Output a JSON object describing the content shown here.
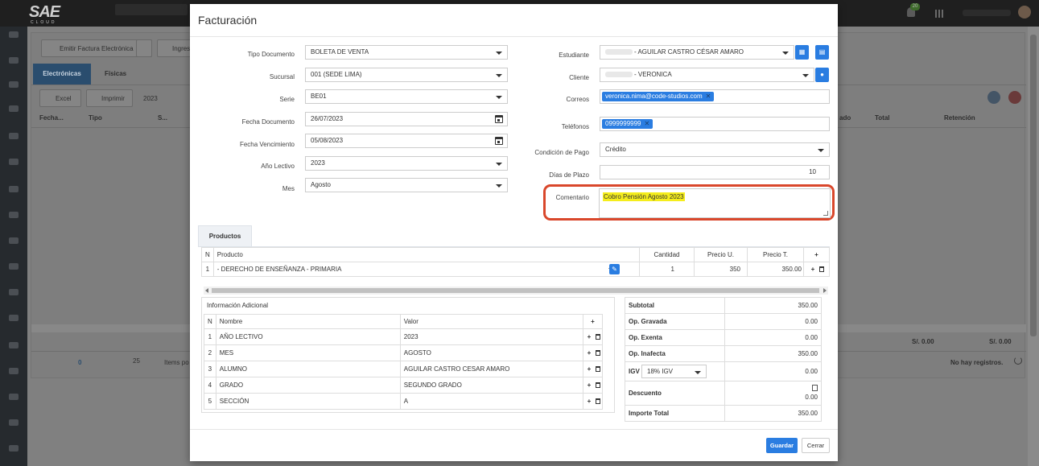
{
  "app": {
    "logo": "SAE",
    "logo_sub": "CLOUD",
    "notif_count": "20"
  },
  "bg": {
    "toolbar": {
      "emitir": "Emitir Factura Electrónica",
      "ingresar": "Ingres"
    },
    "tabs": [
      "Electrónicas",
      "Físicas"
    ],
    "excel": "Excel",
    "imprimir": "Imprimir",
    "year": "2023",
    "columns": {
      "fecha": "Fecha...",
      "tipo": "Tipo",
      "s": "S...",
      "estado": "ado",
      "total": "Total",
      "retencion": "Retención"
    },
    "footer": {
      "page": "0",
      "pagesize": "25",
      "items_por": "Items po",
      "sum1": "S/. 0.00",
      "sum2": "S/. 0.00",
      "no_records": "No hay registros."
    }
  },
  "modal": {
    "title": "Facturación",
    "left_fields": [
      {
        "label": "Tipo Documento",
        "value": "BOLETA DE VENTA",
        "kind": "select"
      },
      {
        "label": "Sucursal",
        "value": "001 (SEDE LIMA)",
        "kind": "select"
      },
      {
        "label": "Serie",
        "value": "BE01",
        "kind": "select"
      },
      {
        "label": "Fecha Documento",
        "value": "26/07/2023",
        "kind": "date"
      },
      {
        "label": "Fecha Vencimiento",
        "value": "05/08/2023",
        "kind": "date"
      },
      {
        "label": "Año Lectivo",
        "value": "2023",
        "kind": "select"
      },
      {
        "label": "Mes",
        "value": "Agosto",
        "kind": "select"
      }
    ],
    "estudiante": {
      "label": "Estudiante",
      "value": "- AGUILAR CASTRO CÉSAR AMARO"
    },
    "cliente": {
      "label": "Cliente",
      "value": "- VERONICA"
    },
    "correos": {
      "label": "Correos",
      "chip": "veronica.nima@code-studios.com"
    },
    "telefonos": {
      "label": "Teléfonos",
      "chip": "0999999999"
    },
    "condicion": {
      "label": "Condición de Pago",
      "value": "Crédito"
    },
    "dias": {
      "label": "Días de Plazo",
      "value": "10"
    },
    "comentario": {
      "label": "Comentario",
      "value": "Cobro Pensión Agosto 2023"
    },
    "productos_tab": "Productos",
    "products": {
      "headers": {
        "n": "N",
        "producto": "Producto",
        "cantidad": "Cantidad",
        "precio_u": "Precio U.",
        "precio_t": "Precio T.",
        "add": "+"
      },
      "rows": [
        {
          "n": "1",
          "producto": "- DERECHO DE ENSEÑANZA - PRIMARIA",
          "cantidad": "1",
          "precio_u": "350",
          "precio_t": "350.00"
        }
      ]
    },
    "info": {
      "title": "Información Adicional",
      "headers": {
        "n": "N",
        "nombre": "Nombre",
        "valor": "Valor",
        "add": "+"
      },
      "rows": [
        {
          "n": "1",
          "nombre": "AÑO LECTIVO",
          "valor": "2023"
        },
        {
          "n": "2",
          "nombre": "MES",
          "valor": "AGOSTO"
        },
        {
          "n": "3",
          "nombre": "ALUMNO",
          "valor": "AGUILAR CASTRO CESAR AMARO"
        },
        {
          "n": "4",
          "nombre": "GRADO",
          "valor": "SEGUNDO GRADO"
        },
        {
          "n": "5",
          "nombre": "SECCIÓN",
          "valor": "A"
        }
      ]
    },
    "totals": {
      "subtotal": {
        "label": "Subtotal",
        "value": "350.00"
      },
      "gravada": {
        "label": "Op. Gravada",
        "value": "0.00"
      },
      "exenta": {
        "label": "Op. Exenta",
        "value": "0.00"
      },
      "inafecta": {
        "label": "Op. Inafecta",
        "value": "350.00"
      },
      "igv": {
        "label": "IGV",
        "select": "18% IGV",
        "value": "0.00"
      },
      "descuento": {
        "label": "Descuento",
        "value": "0.00"
      },
      "importe": {
        "label": "Importe Total",
        "value": "350.00"
      }
    },
    "buttons": {
      "guardar": "Guardar",
      "cerrar": "Cerrar"
    }
  }
}
